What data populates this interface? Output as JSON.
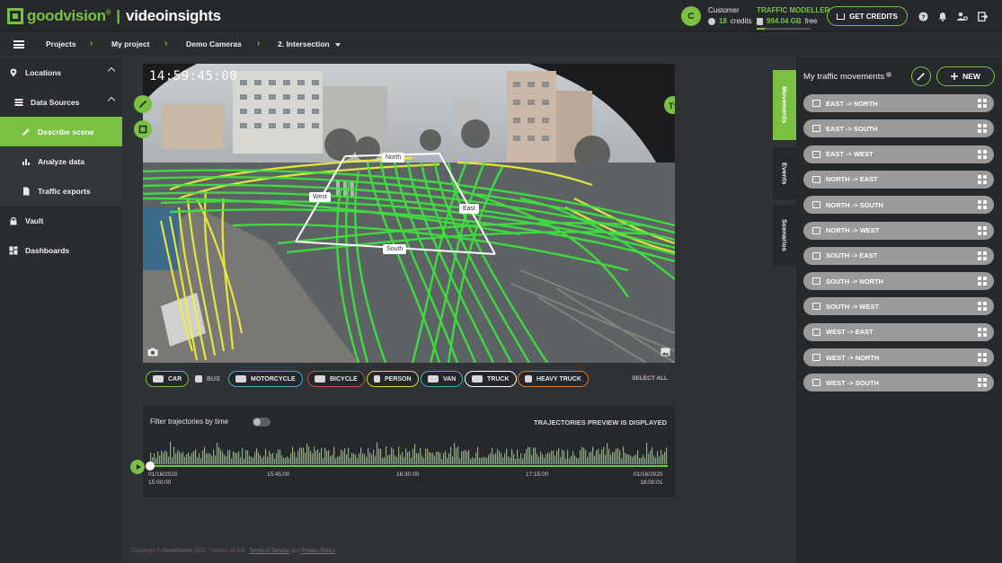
{
  "header": {
    "logo_brand": "goodvision",
    "logo_reg": "®",
    "logo_separator": "|",
    "logo_product": "videoinsights",
    "avatar_initial": "C",
    "customer_label": "Customer",
    "credits_value": "18",
    "credits_label": "credits",
    "plan_name": "TRAFFIC MODELLER",
    "storage_value": "994.04 GB",
    "storage_label": "free",
    "storage_fill_fraction": 0.15,
    "get_credits_label": "GET CREDITS",
    "help_icon": "question-icon",
    "notifications_icon": "bell-icon",
    "settings_icon": "user-settings-icon",
    "logout_icon": "logout-icon"
  },
  "breadcrumb": {
    "items": [
      "Projects",
      "My project",
      "Demo Cameras",
      "2. Intersection"
    ]
  },
  "sidebar": {
    "items": [
      {
        "label": "Locations",
        "icon": "map-pin-icon"
      },
      {
        "label": "Data Sources",
        "icon": "database-icon"
      },
      {
        "label": "Describe scene",
        "icon": "pencil-icon"
      },
      {
        "label": "Analyze data",
        "icon": "bar-chart-icon"
      },
      {
        "label": "Traffic exports",
        "icon": "document-icon"
      },
      {
        "label": "Vault",
        "icon": "lock-icon"
      },
      {
        "label": "Dashboards",
        "icon": "dashboard-icon"
      }
    ]
  },
  "video": {
    "timestamp": "14:59:45:00",
    "zones": {
      "north": "North",
      "west": "West",
      "east": "East",
      "south": "South"
    }
  },
  "classes": {
    "items": [
      {
        "label": "CAR",
        "active": true
      },
      {
        "label": "BUS",
        "active": false
      },
      {
        "label": "MOTORCYCLE",
        "active": true
      },
      {
        "label": "BICYCLE",
        "active": true
      },
      {
        "label": "PERSON",
        "active": true
      },
      {
        "label": "VAN",
        "active": true
      },
      {
        "label": "TRUCK",
        "active": true
      },
      {
        "label": "HEAVY TRUCK",
        "active": true
      }
    ],
    "select_all": "SELECT ALL"
  },
  "timeline": {
    "filter_label": "Filter trajectories by time",
    "status": "TRAJECTORIES PREVIEW IS DISPLAYED",
    "ticks": [
      {
        "date": "01/16/2020",
        "time": "15:00:00"
      },
      {
        "date": "",
        "time": "15:45:00"
      },
      {
        "date": "",
        "time": "16:30:00"
      },
      {
        "date": "",
        "time": "17:15:00"
      },
      {
        "date": "01/16/2020",
        "time": "18:00:01"
      }
    ]
  },
  "vtabs": {
    "movements": "Movements",
    "events": "Events",
    "scenarios": "Scenarios"
  },
  "movements_panel": {
    "title": "My traffic movements",
    "new_label": "NEW",
    "items": [
      "EAST -> NORTH",
      "EAST -> SOUTH",
      "EAST -> WEST",
      "NORTH -> EAST",
      "NORTH -> SOUTH",
      "NORTH -> WEST",
      "SOUTH -> EAST",
      "SOUTH -> NORTH",
      "SOUTH -> WEST",
      "WEST -> EAST",
      "WEST -> NORTH",
      "WEST -> SOUTH"
    ]
  },
  "footer": {
    "copyright": "Copyright © ",
    "company": "GoodVision",
    "year": " 2022",
    "version": "Version 26.0.8",
    "terms": "Terms of Service",
    "and": "and",
    "privacy": "Privacy Policy"
  }
}
